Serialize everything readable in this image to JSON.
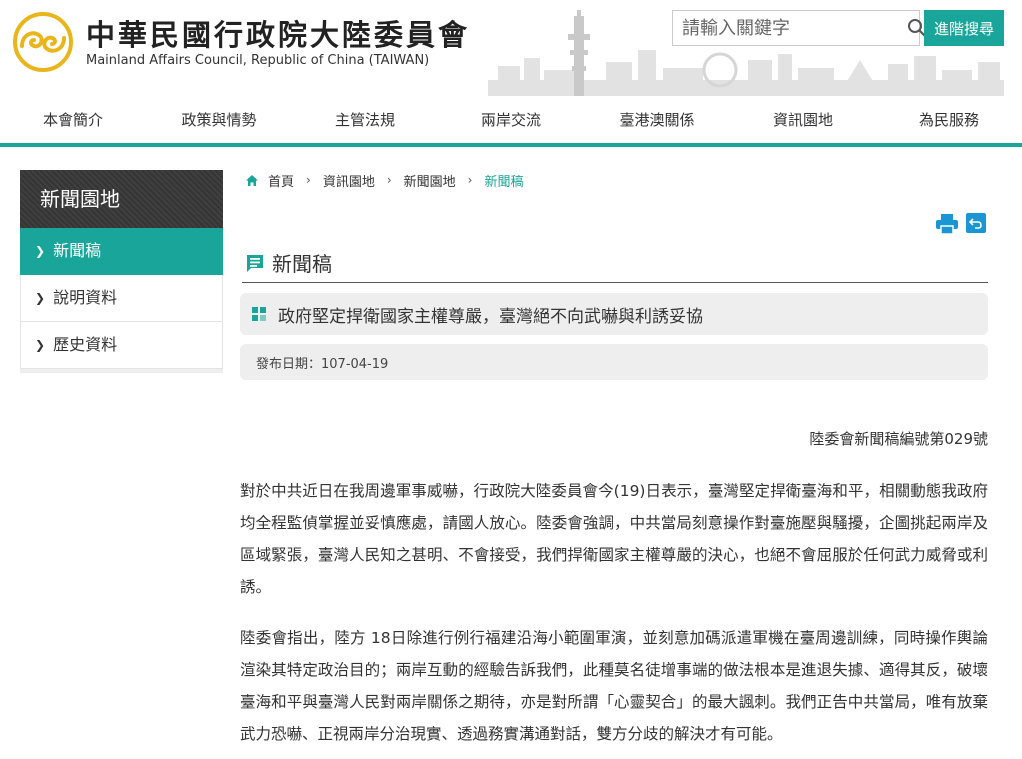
{
  "header": {
    "title_zh": "中華民國行政院大陸委員會",
    "title_en": "Mainland Affairs Council, Republic of China (TAIWAN)",
    "search_placeholder": "請輸入關鍵字",
    "advanced_search": "進階搜尋"
  },
  "nav": {
    "items": [
      "本會簡介",
      "政策與情勢",
      "主管法規",
      "兩岸交流",
      "臺港澳關係",
      "資訊園地",
      "為民服務"
    ]
  },
  "sidebar": {
    "title": "新聞園地",
    "items": [
      "新聞稿",
      "說明資料",
      "歷史資料"
    ]
  },
  "breadcrumb": {
    "items": [
      "首頁",
      "資訊園地",
      "新聞園地",
      "新聞稿"
    ]
  },
  "section": {
    "heading": "新聞稿"
  },
  "article": {
    "title": "政府堅定捍衛國家主權尊嚴，臺灣絕不向武嚇與利誘妥協",
    "date": "發布日期：107-04-19",
    "press_no": "陸委會新聞稿編號第029號",
    "paragraphs": [
      "對於中共近日在我周邊軍事威嚇，行政院大陸委員會今(19)日表示，臺灣堅定捍衛臺海和平，相關動態我政府均全程監偵掌握並妥慎應處，請國人放心。陸委會強調，中共當局刻意操作對臺施壓與騷擾，企圖挑起兩岸及區域緊張，臺灣人民知之甚明、不會接受，我們捍衛國家主權尊嚴的決心，也絕不會屈服於任何武力威脅或利誘。",
      "陸委會指出，陸方 18日除進行例行福建沿海小範圍軍演，並刻意加碼派遣軍機在臺周邊訓練，同時操作輿論渲染其特定政治目的；兩岸互動的經驗告訴我們，此種莫名徒增事端的做法根本是進退失據、適得其反，破壞臺海和平與臺灣人民對兩岸關係之期待，亦是對所謂「心靈契合」的最大諷刺。我們正告中共當局，唯有放棄武力恐嚇、正視兩岸分治現實、透過務實溝通對話，雙方分歧的解決才有可能。"
    ]
  },
  "colors": {
    "accent": "#1aa59a",
    "logo": "#e8b61c",
    "sidebar_title_bg": "#3a3a3a",
    "panel_bg": "#eeeeee"
  },
  "icons": [
    "logo-icon",
    "search-icon",
    "home-icon",
    "chevron-right-icon",
    "print-icon",
    "back-icon",
    "news-icon",
    "grid-icon"
  ]
}
